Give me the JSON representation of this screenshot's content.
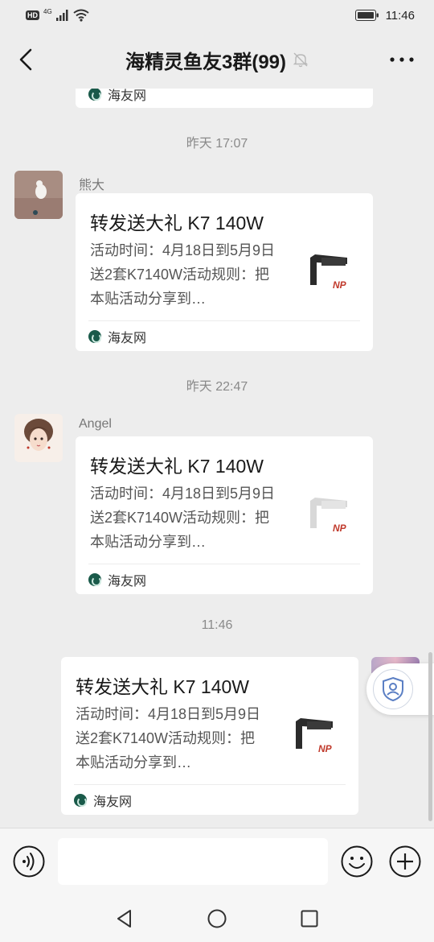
{
  "status_bar": {
    "hd_badge": "HD",
    "network": "4G",
    "time": "11:46"
  },
  "header": {
    "title": "海精灵鱼友3群(99)"
  },
  "partial_card": {
    "source": "海友网"
  },
  "messages": [
    {
      "timestamp": "昨天 17:07",
      "sender": "熊大",
      "card": {
        "title": "转发送大礼 K7 140W",
        "desc": "活动时间：4月18日到5月9日送2套K7140W活动规则：把本贴活动分享到…",
        "source": "海友网",
        "thumb_color": "#2b2b2b"
      }
    },
    {
      "timestamp": "昨天 22:47",
      "sender": "Angel",
      "card": {
        "title": "转发送大礼 K7 140W",
        "desc": "活动时间：4月18日到5月9日送2套K7140W活动规则：把本贴活动分享到…",
        "source": "海友网",
        "thumb_color": "#d8d8d8"
      }
    },
    {
      "timestamp": "11:46",
      "sender": "",
      "card": {
        "title": "转发送大礼 K7 140W",
        "desc": "活动时间：4月18日到5月9日送2套K7140W活动规则：把本贴活动分享到…",
        "source": "海友网",
        "thumb_color": "#2b2b2b"
      }
    }
  ],
  "input": {
    "placeholder": ""
  },
  "colors": {
    "background": "#ededed",
    "card": "#ffffff",
    "accent_red": "#c0392b"
  }
}
